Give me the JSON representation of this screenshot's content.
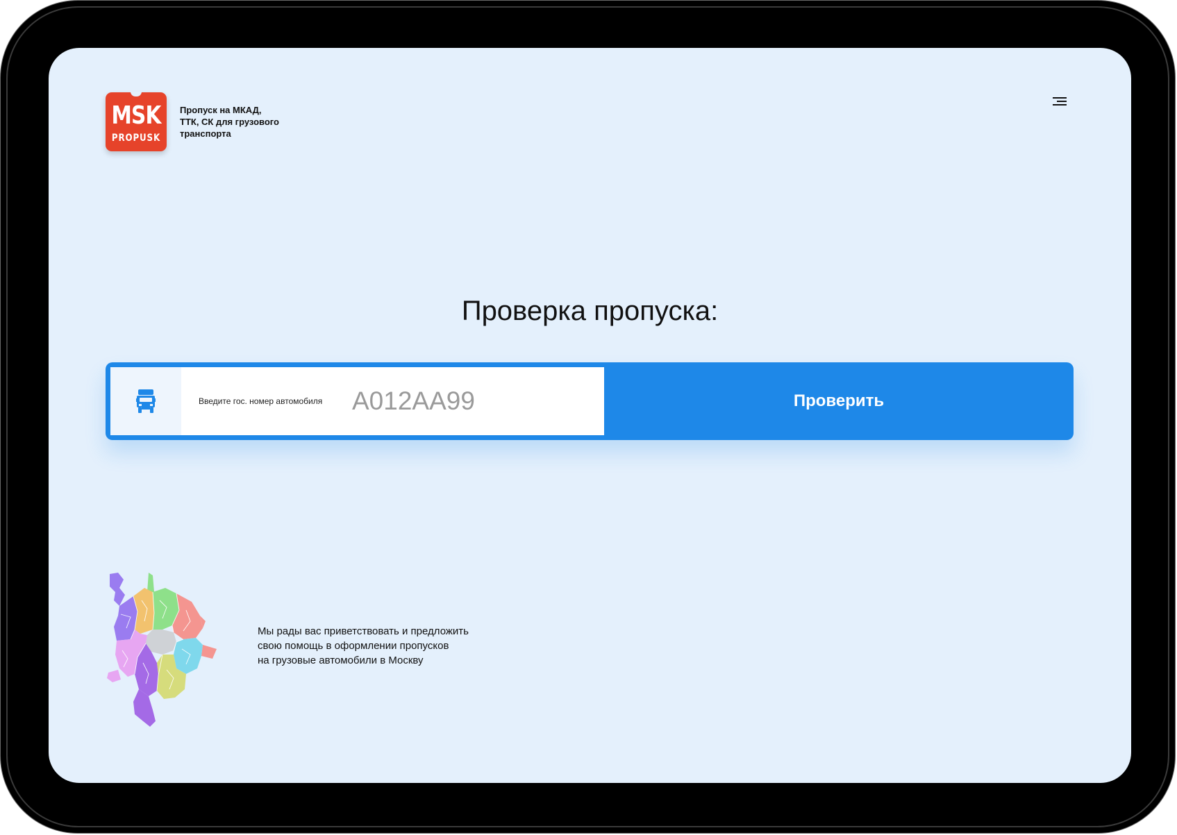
{
  "brand": {
    "logo_top": "MSK",
    "logo_bottom": "PROPUSK",
    "tagline_lines": [
      "Пропуск на МКАД,",
      "ТТК, СК для грузового",
      "транспорта"
    ]
  },
  "header": {
    "menu_icon": "hamburger-menu-icon"
  },
  "main": {
    "title": "Проверка пропуска:",
    "field_label": "Введите гос. номер автомобиля",
    "plate_placeholder": "А012АА99",
    "plate_value": "",
    "submit_label": "Проверить",
    "field_icon": "truck-icon"
  },
  "footer": {
    "map_icon": "moscow-districts-map",
    "welcome_lines": [
      "Мы рады вас приветствовать и предложить",
      "свою помощь в оформлении пропусков",
      "на грузовые автомобили в Москву"
    ]
  },
  "colors": {
    "accent": "#1e88e8",
    "logo_red": "#e6432a",
    "screen_bg": "#e4f0fc",
    "bezel": "#000000"
  }
}
